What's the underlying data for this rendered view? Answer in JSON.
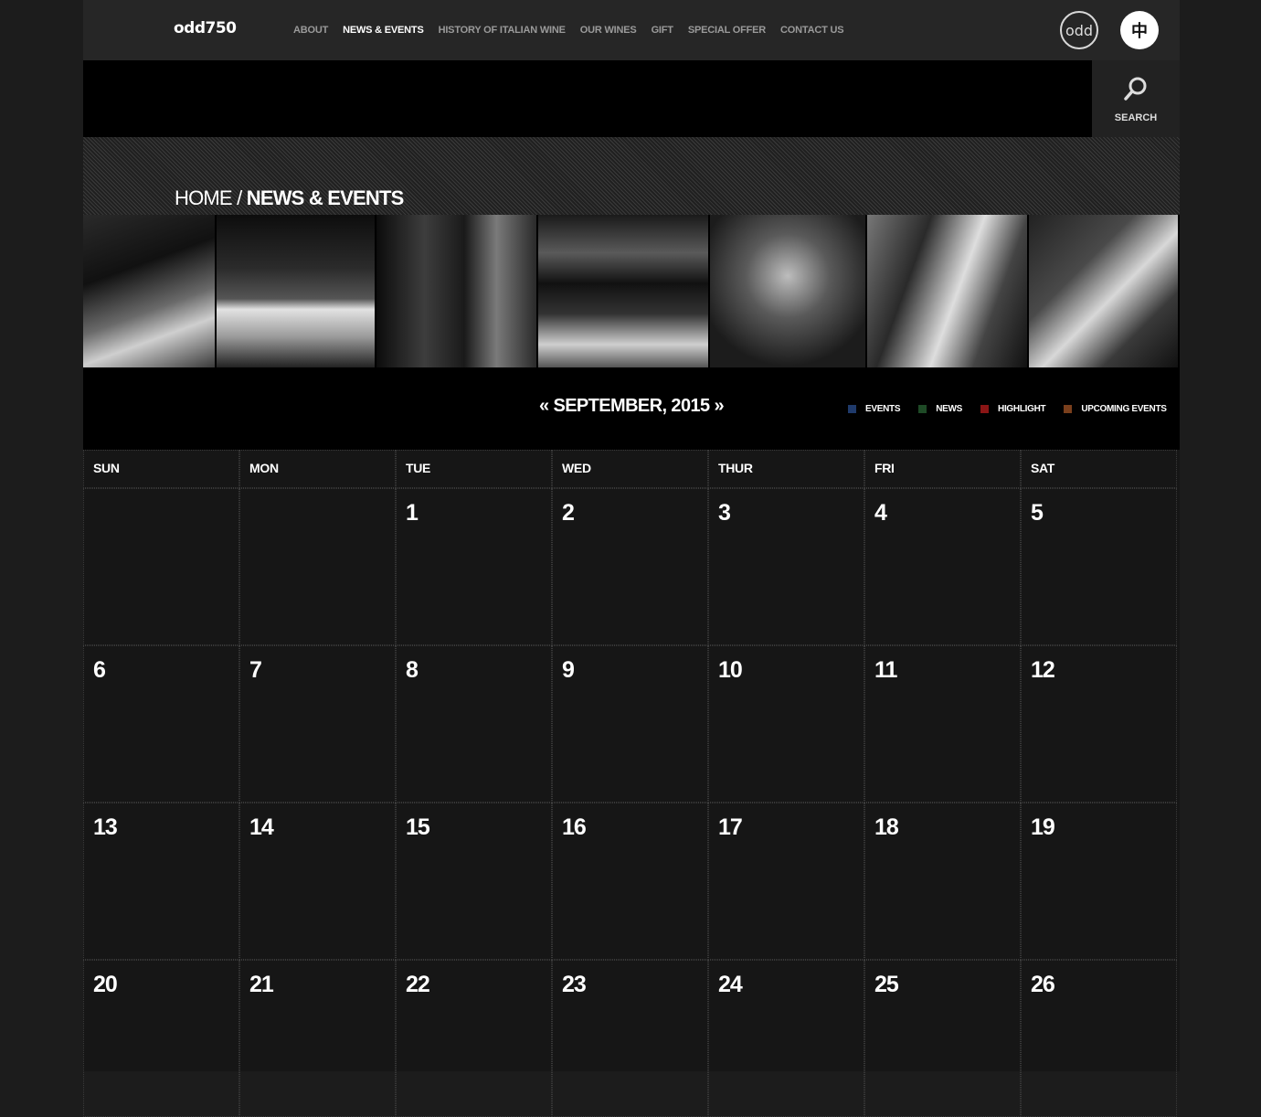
{
  "header": {
    "logo": "odd750",
    "nav": [
      "ABOUT",
      "NEWS & EVENTS",
      "HISTORY OF ITALIAN WINE",
      "OUR WINES",
      "GIFT",
      "SPECIAL OFFER",
      "CONTACT US"
    ],
    "active_nav": "NEWS & EVENTS",
    "brand_badge": "odd",
    "language_button": "中"
  },
  "search": {
    "label": "SEARCH",
    "icon": "search-icon"
  },
  "breadcrumb": {
    "home": "HOME",
    "separator": " / ",
    "current": "NEWS & EVENTS"
  },
  "photo_strip": [
    "wine-bar-counter-photo",
    "presenters-photo",
    "wine-list-display-photo",
    "tasting-room-photo",
    "wine-glasses-photo",
    "tasting-glasses-photo",
    "wine-gift-box-photo"
  ],
  "calendar": {
    "prev_arrow": "«",
    "month_label": "SEPTEMBER, 2015",
    "next_arrow": "»",
    "legend": [
      {
        "label": "EVENTS",
        "color": "#1f3a6b"
      },
      {
        "label": "NEWS",
        "color": "#1e4a26"
      },
      {
        "label": "HIGHLIGHT",
        "color": "#8a1515"
      },
      {
        "label": "UPCOMING EVENTS",
        "color": "#7a3f1c"
      }
    ],
    "weekdays": [
      "SUN",
      "MON",
      "TUE",
      "WED",
      "THUR",
      "FRI",
      "SAT"
    ],
    "weeks": [
      [
        "",
        "",
        "1",
        "2",
        "3",
        "4",
        "5"
      ],
      [
        "6",
        "7",
        "8",
        "9",
        "10",
        "11",
        "12"
      ],
      [
        "13",
        "14",
        "15",
        "16",
        "17",
        "18",
        "19"
      ],
      [
        "20",
        "21",
        "22",
        "23",
        "24",
        "25",
        "26"
      ]
    ]
  },
  "colors": {
    "background": "#161616",
    "header": "#262626",
    "text": "#ffffff",
    "muted_nav": "#9a9a9a"
  }
}
